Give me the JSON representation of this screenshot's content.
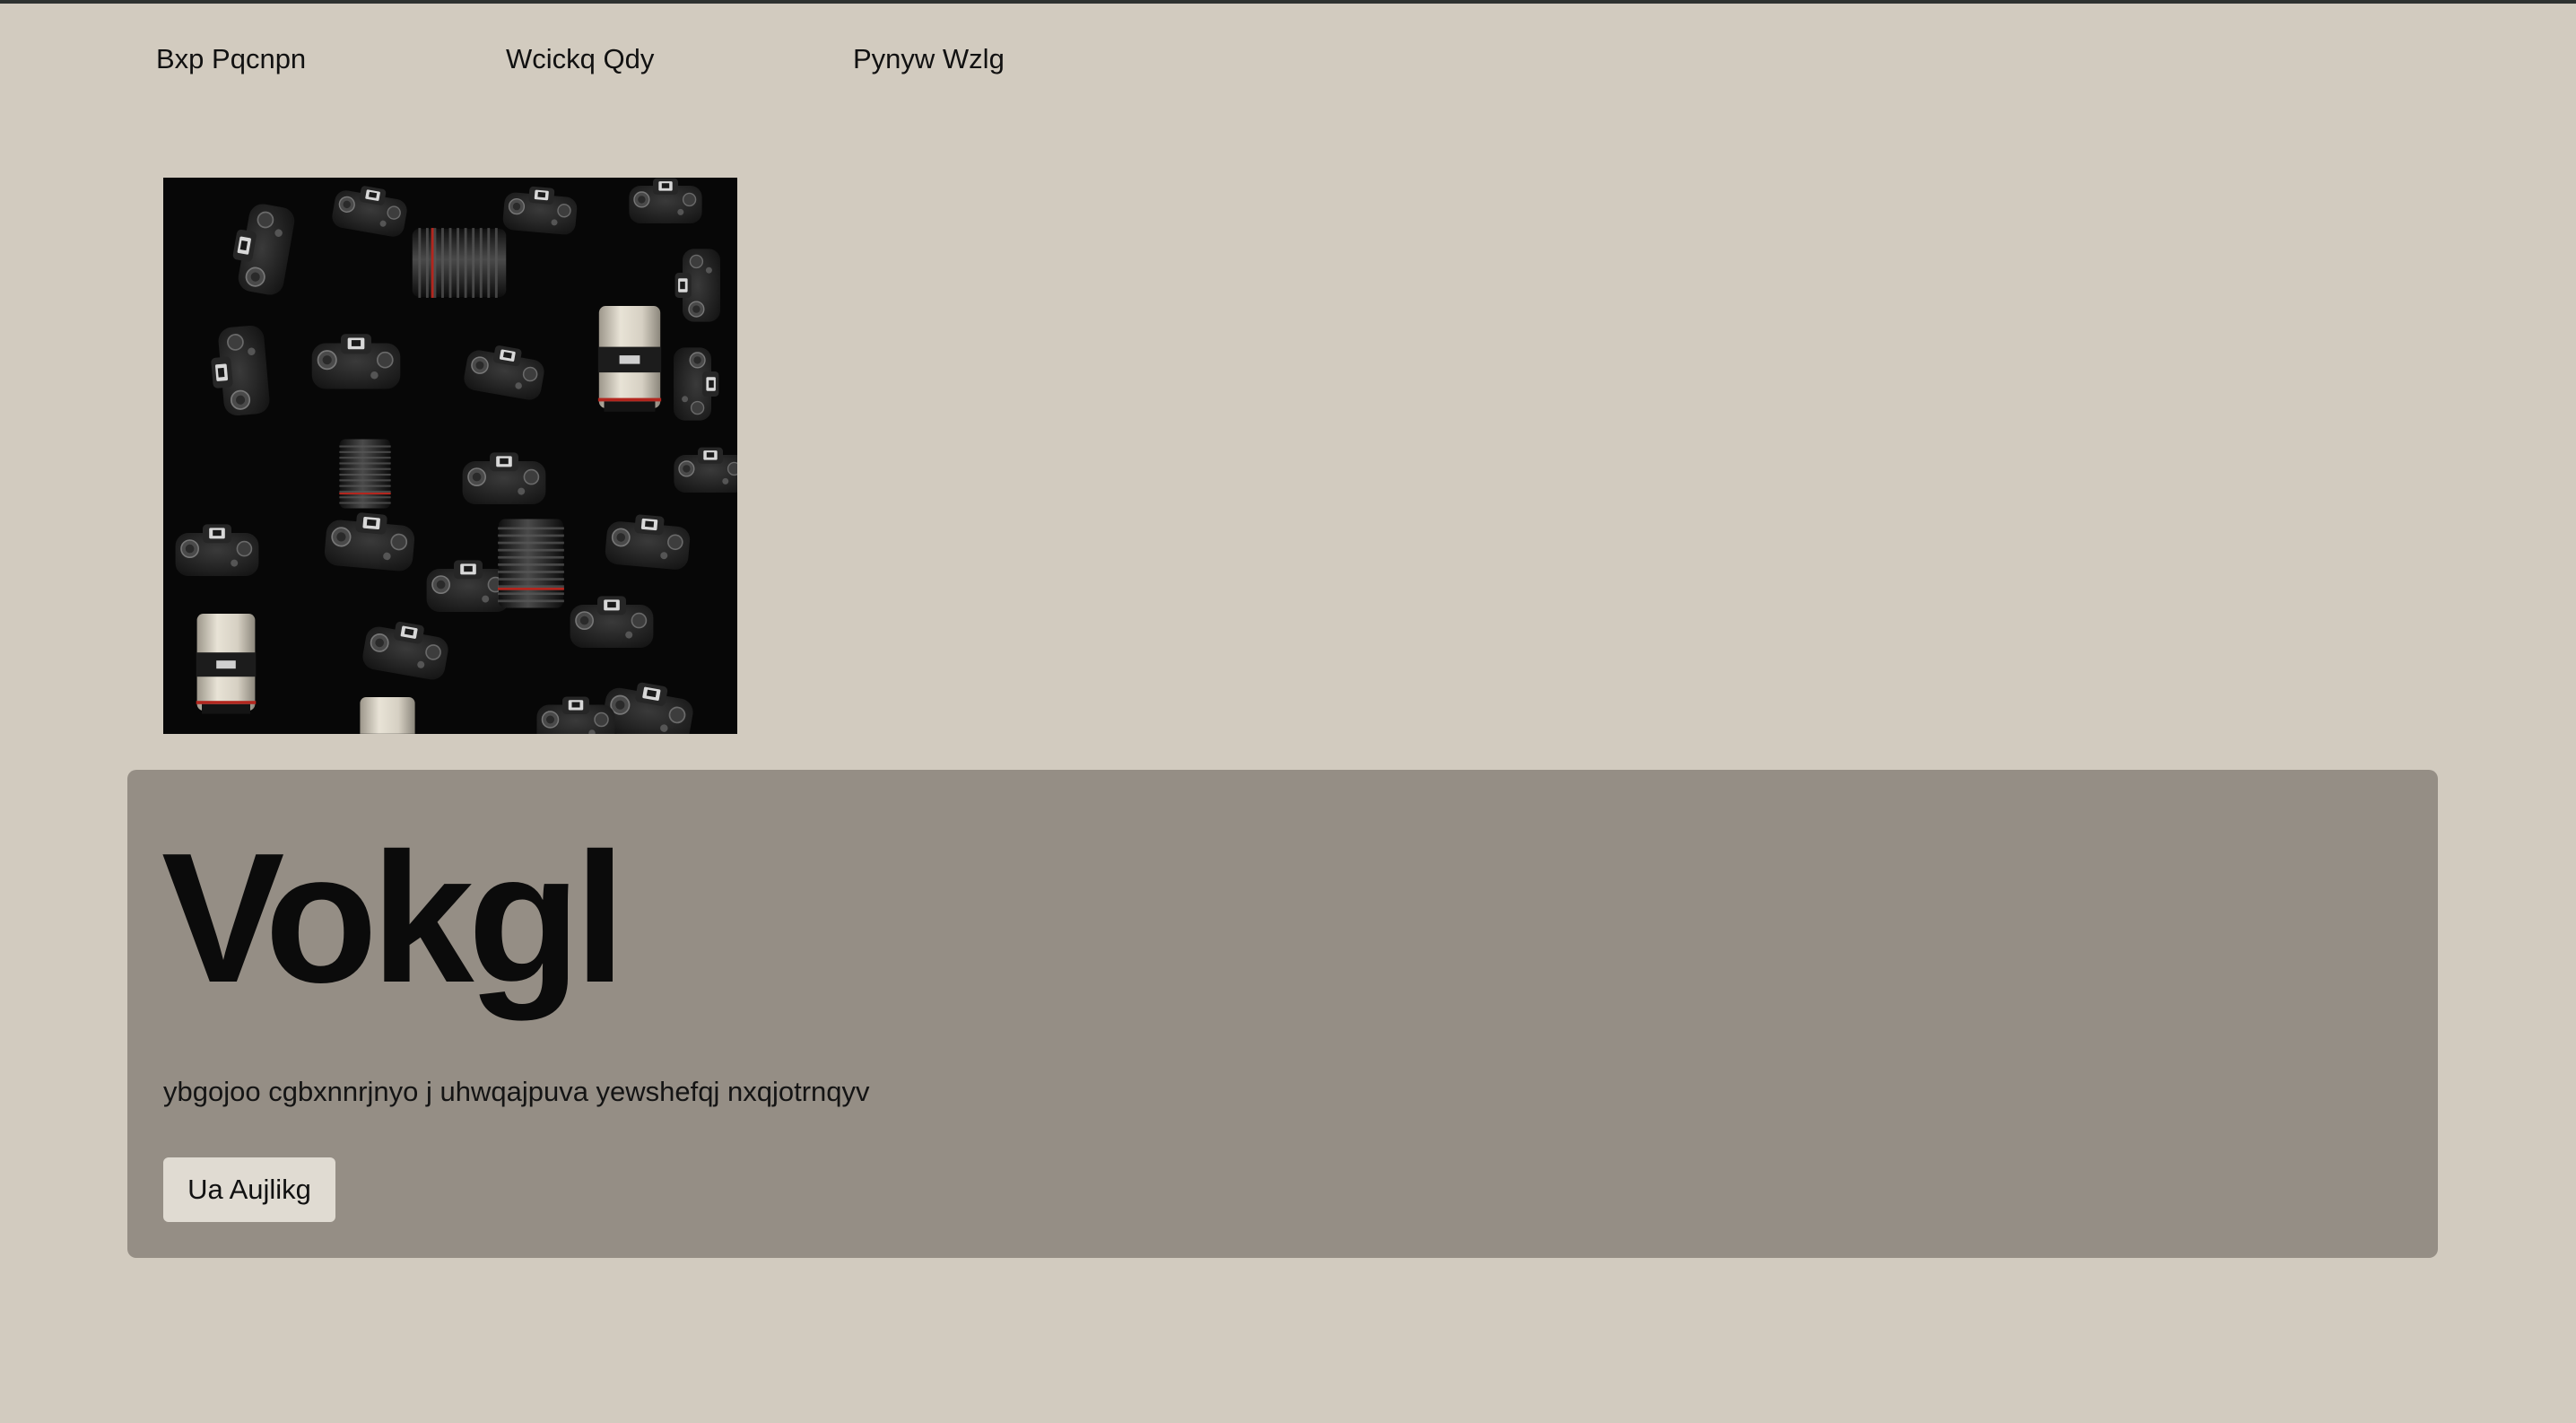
{
  "nav": {
    "links": [
      {
        "label": "Bxp Pqcnpn"
      },
      {
        "label": "Wcickq Qdy"
      },
      {
        "label": "Pynyw Wzlg"
      }
    ]
  },
  "hero": {
    "image_alt": "cameras-and-lenses-photo"
  },
  "panel": {
    "title": "Vokgl",
    "text": "ybgojoo cgbxnnrjnyo j uhwqajpuva yewshefqj nxqjotrnqyv",
    "button_label": "Ua Aujlikg"
  },
  "colors": {
    "page_background": "#d2cbbf",
    "panel_background": "#958e85",
    "button_background": "#e0dbd2",
    "text": "#111111"
  }
}
